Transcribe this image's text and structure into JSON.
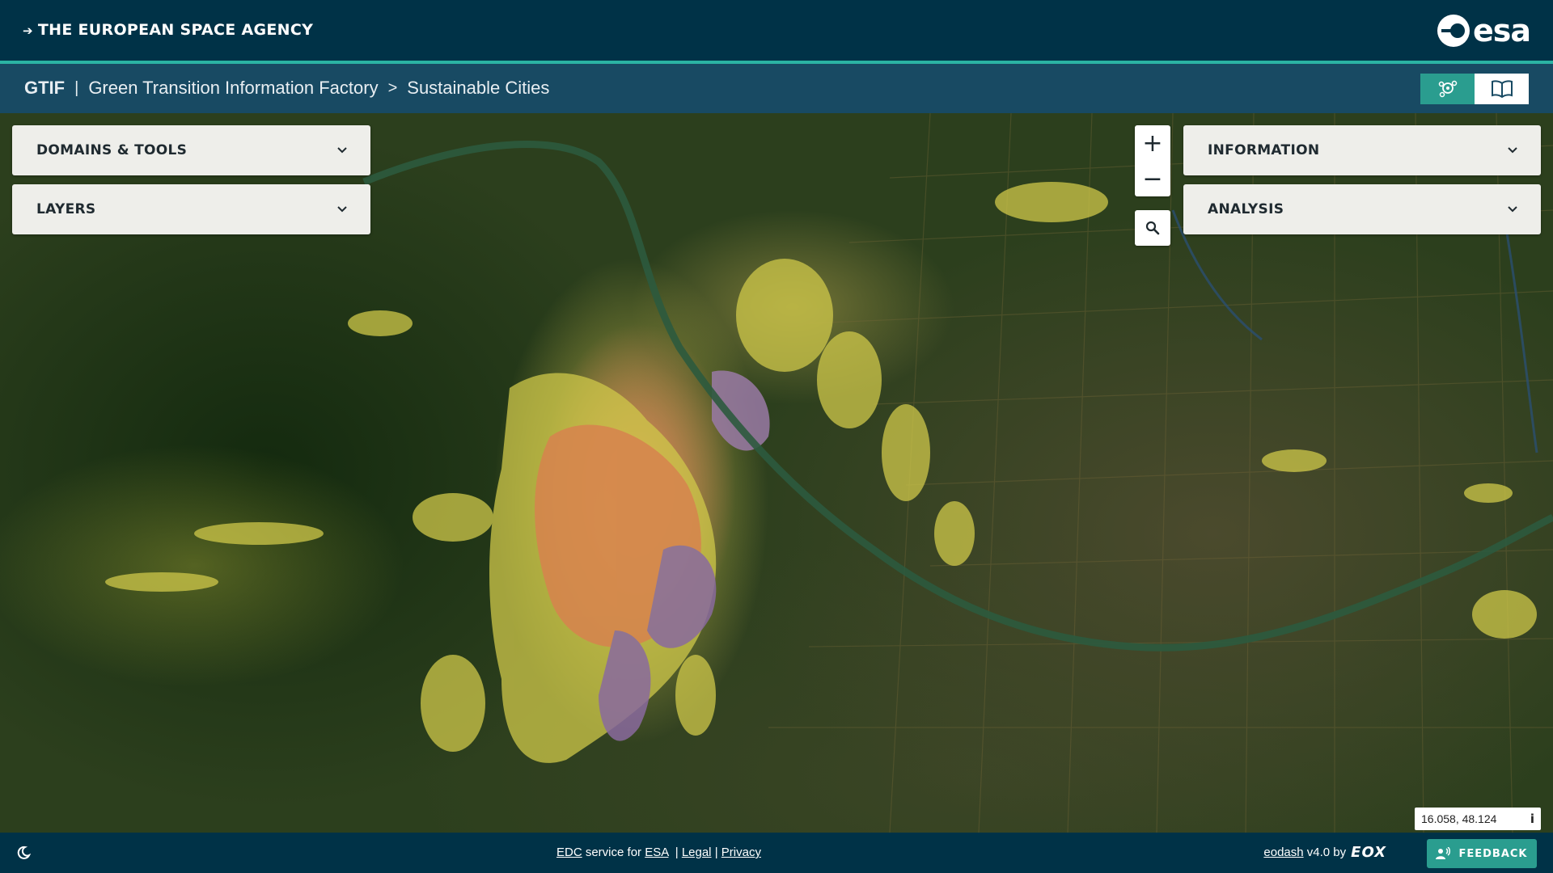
{
  "esa_bar": {
    "agency_link": "THE EUROPEAN SPACE AGENCY",
    "logo_text": "esa"
  },
  "header": {
    "short_name": "GTIF",
    "separator": "|",
    "full_name": "Green Transition Information Factory",
    "crumb_separator": ">",
    "current_page": "Sustainable Cities",
    "buttons": [
      {
        "icon": "explore-icon",
        "active": true
      },
      {
        "icon": "book-icon",
        "active": false
      }
    ]
  },
  "panels": {
    "domains_tools": "DOMAINS & TOOLS",
    "layers": "LAYERS",
    "information": "INFORMATION",
    "analysis": "ANALYSIS"
  },
  "map_controls": {
    "zoom_in": "+",
    "zoom_out": "−",
    "search_icon": "search-icon"
  },
  "coordinates": {
    "value": "16.058, 48.124",
    "info_label": "i"
  },
  "footer": {
    "theme_icon": "moon-icon",
    "edc": "EDC",
    "service_for": "service for",
    "esa": "ESA",
    "sep1": "|",
    "legal": "Legal",
    "sep2": "|",
    "privacy": "Privacy",
    "eodash": "eodash",
    "version": "v4.0 by",
    "eox": "EOX",
    "feedback": "FEEDBACK"
  },
  "colors": {
    "top_bar": "#003247",
    "header": "#184a63",
    "accent": "#2a9d8f",
    "panel_bg": "#eeeeea"
  }
}
